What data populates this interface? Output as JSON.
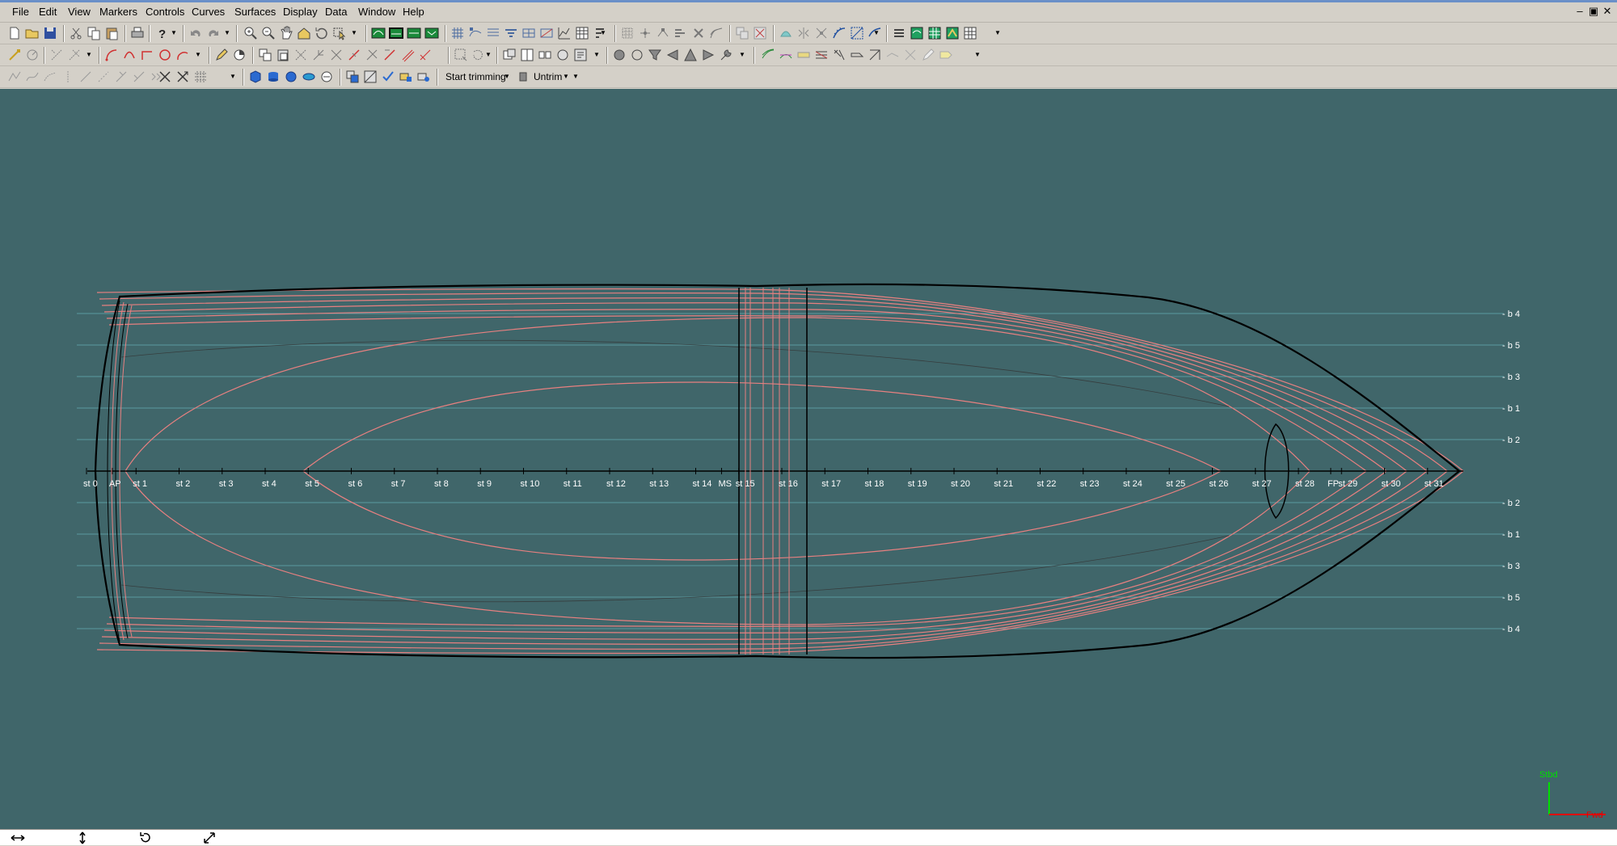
{
  "colors": {
    "viewport_bg": "#40666a",
    "hull_outline": "#000000",
    "lines_red": "#e88080",
    "buttock_cyan": "#5a9aa0",
    "axis_stbd": "#00e000",
    "axis_x": "#e00000"
  },
  "menu": {
    "file": "File",
    "edit": "Edit",
    "view": "View",
    "markers": "Markers",
    "controls": "Controls",
    "curves": "Curves",
    "surfaces": "Surfaces",
    "display": "Display",
    "data": "Data",
    "window": "Window",
    "help": "Help"
  },
  "window_controls": {
    "minimize": "–",
    "restore": "▣",
    "close": "✕"
  },
  "toolbar3": {
    "start_trimming_label": "Start trimming",
    "untrim_label": "Untrim"
  },
  "stations": [
    {
      "label": "st 0",
      "station": 0
    },
    {
      "label": "AP",
      "station": 0.45
    },
    {
      "label": "st 1",
      "station": 1
    },
    {
      "label": "st 2",
      "station": 2
    },
    {
      "label": "st 3",
      "station": 3
    },
    {
      "label": "st 4",
      "station": 4
    },
    {
      "label": "st 5",
      "station": 5
    },
    {
      "label": "st 6",
      "station": 6
    },
    {
      "label": "st 7",
      "station": 7
    },
    {
      "label": "st 8",
      "station": 8
    },
    {
      "label": "st 9",
      "station": 9
    },
    {
      "label": "st 10",
      "station": 10
    },
    {
      "label": "st 11",
      "station": 11
    },
    {
      "label": "st 12",
      "station": 12
    },
    {
      "label": "st 13",
      "station": 13
    },
    {
      "label": "st 14",
      "station": 14
    },
    {
      "label": "MS",
      "station": 14.6
    },
    {
      "label": "st 15",
      "station": 15
    },
    {
      "label": "st 16",
      "station": 16
    },
    {
      "label": "st 17",
      "station": 17
    },
    {
      "label": "st 18",
      "station": 18
    },
    {
      "label": "st 19",
      "station": 19
    },
    {
      "label": "st 20",
      "station": 20
    },
    {
      "label": "st 21",
      "station": 21
    },
    {
      "label": "st 22",
      "station": 22
    },
    {
      "label": "st 23",
      "station": 23
    },
    {
      "label": "st 24",
      "station": 24
    },
    {
      "label": "st 25",
      "station": 25
    },
    {
      "label": "st 26",
      "station": 26
    },
    {
      "label": "st 27",
      "station": 27
    },
    {
      "label": "st 28",
      "station": 28
    },
    {
      "label": "FP",
      "station": 28.75
    },
    {
      "label": "st 29",
      "station": 29
    },
    {
      "label": "st 30",
      "station": 30
    },
    {
      "label": "st 31",
      "station": 31
    }
  ],
  "buttocks": [
    {
      "label": "b 4",
      "side": 4
    },
    {
      "label": "b 5",
      "side": 3
    },
    {
      "label": "b 3",
      "side": 2
    },
    {
      "label": "b 1",
      "side": 1
    },
    {
      "label": "b 2",
      "side": 0
    },
    {
      "label": "b 2",
      "side": -1
    },
    {
      "label": "b 1",
      "side": -2
    },
    {
      "label": "b 3",
      "side": -3
    },
    {
      "label": "b 5",
      "side": -4
    },
    {
      "label": "b 4",
      "side": -5
    }
  ],
  "axis_triad": {
    "up_label": "Stbd",
    "right_label": "Fwd"
  }
}
